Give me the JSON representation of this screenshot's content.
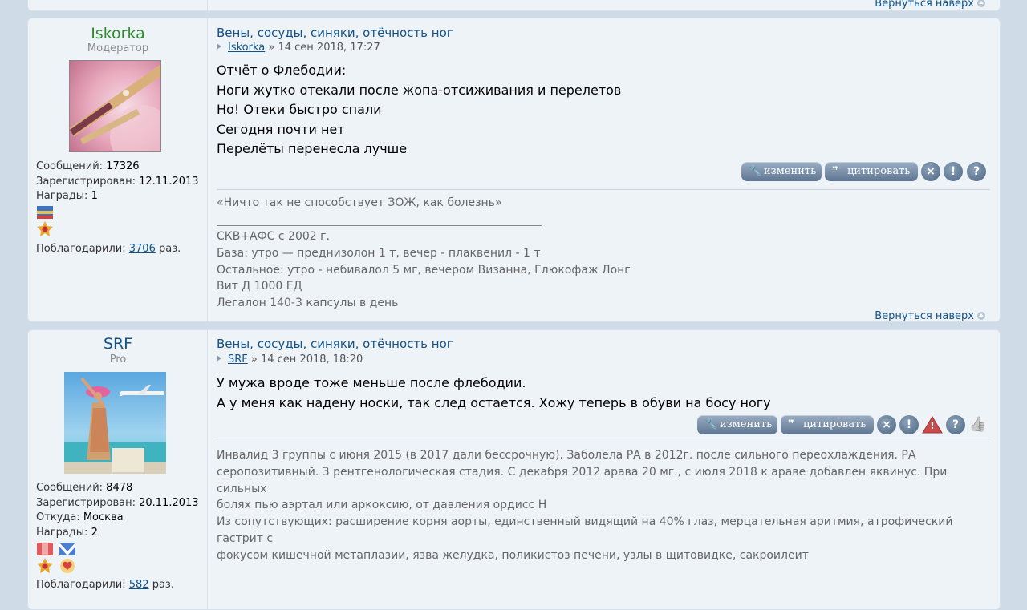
{
  "back_to_top": "Вернуться наверх",
  "posts": [
    {
      "username": "Iskorka",
      "username_color": "#2e8a2e",
      "rank": "Модератор",
      "stats": {
        "posts_label": "Сообщений:",
        "posts": "17326",
        "registered_label": "Зарегистрирован:",
        "registered": "12.11.2013",
        "awards_label": "Награды:",
        "awards": "1",
        "thanked_label": "Поблагодарили:",
        "thanked": "3706",
        "thanked_suffix": "раз."
      },
      "title": "Вены, сосуды, синяки, отёчность ног",
      "author": "Iskorka",
      "date": "» 14 сен 2018, 17:27",
      "body": [
        "Отчёт о Флебодии:",
        "Ноги жутко отекали после жопа-отсиживания и перелетов",
        "Но! Отеки быстро спали",
        "Сегодня почти нет",
        "Перелёты перенесла лучше"
      ],
      "buttons": {
        "edit": "изменить",
        "quote": "цитировать",
        "delete_icon": "×",
        "report_icon": "!",
        "info_icon": "?"
      },
      "signature": [
        "«Ничто так не способствует ЗОЖ, как болезнь»",
        "СКВ+АФС с 2002 г.",
        "База: утро — преднизолон 1 т, вечер - плаквенил - 1 т",
        "Остальное: утро - небивалол 5 мг, вечером Визанна, Глюкофаж Лонг",
        "Вит Д 1000 ЕД",
        "Легалон 140-3 капсулы в день"
      ]
    },
    {
      "username": "SRF",
      "username_color": "#105289",
      "rank": "Pro",
      "stats": {
        "posts_label": "Сообщений:",
        "posts": "8478",
        "registered_label": "Зарегистрирован:",
        "registered": "20.11.2013",
        "from_label": "Откуда:",
        "from": "Москва",
        "awards_label": "Награды:",
        "awards": "2",
        "thanked_label": "Поблагодарили:",
        "thanked": "582",
        "thanked_suffix": "раз."
      },
      "title": "Вены, сосуды, синяки, отёчность ног",
      "author": "SRF",
      "date": "» 14 сен 2018, 18:20",
      "body": [
        "У мужа вроде тоже меньше после флебодии.",
        "А у меня как надену носки, так след остается. Хожу теперь в обуви на босу ногу"
      ],
      "buttons": {
        "edit": "изменить",
        "quote": "цитировать",
        "delete_icon": "×",
        "report_icon": "!",
        "warn_icon": "!",
        "info_icon": "?",
        "thanks_icon": "👍"
      },
      "signature": [
        "Инвалид 3 группы с июня 2015 (в 2017 дали бессрочную). Заболела РА в 2012г. после сильного переохлаждения. РА",
        "серопозитивный. 3 рентгенологическая стадия. С декабря 2012 арава 20 мг., с июля 2018 к араве добавлен яквинус. При сильных",
        "болях пью аэртал или аркоксию, от давления ордисс Н",
        "Из сопутствующих: расширение корня аорты, единственный видящий на 40% глаз, мерцательная аритмия, атрофический гастрит с",
        "фокусом кишечной метаплазии, язва желудка, поликистоз печени, узлы в щитовидке, сакроилеит"
      ]
    }
  ]
}
